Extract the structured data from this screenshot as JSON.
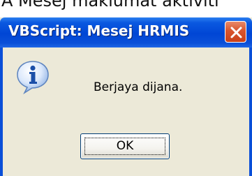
{
  "background_caption": "A Mesej maklumat aktiviti",
  "dialog": {
    "title": "VBScript: Mesej HRMIS",
    "message": "Berjaya dijana.",
    "icon": "info-icon",
    "ok_label": "OK",
    "close_icon": "close-icon"
  },
  "colors": {
    "titlebar": "#0046d5",
    "dialog_body": "#ece9d8",
    "close_button": "#d8552e"
  }
}
